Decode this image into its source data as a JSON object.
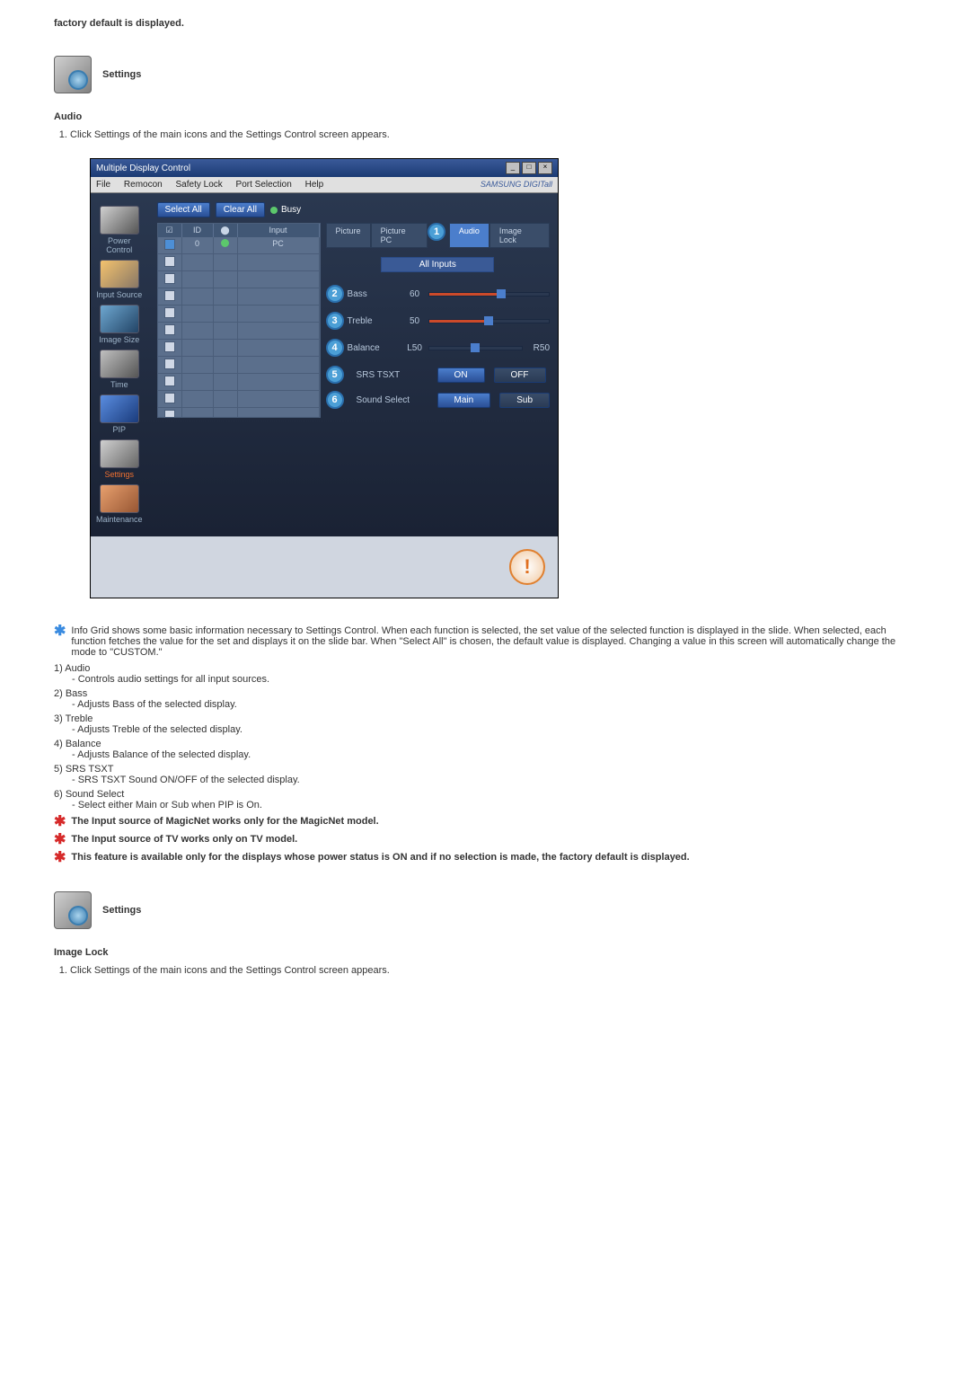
{
  "top_text": "factory default is displayed.",
  "heading1": "Settings",
  "section1_title": "Audio",
  "section1_steps": [
    "Click Settings of the main icons and the Settings Control screen appears."
  ],
  "screenshot": {
    "title": "Multiple Display Control",
    "menu": [
      "File",
      "Remocon",
      "Safety Lock",
      "Port Selection",
      "Help"
    ],
    "brand": "SAMSUNG DIGITall",
    "sidebar": [
      {
        "label": "Power Control"
      },
      {
        "label": "Input Source"
      },
      {
        "label": "Image Size"
      },
      {
        "label": "Time"
      },
      {
        "label": "PIP"
      },
      {
        "label": "Settings",
        "active": true
      },
      {
        "label": "Maintenance"
      }
    ],
    "select_all": "Select All",
    "clear_all": "Clear All",
    "busy": "Busy",
    "grid_headers": {
      "chk": "☑",
      "id": "ID",
      "status": "",
      "input": "Input"
    },
    "grid_row0": {
      "id": "0",
      "input": "PC"
    },
    "tabs": [
      {
        "label": "Picture"
      },
      {
        "label": "Picture PC"
      },
      {
        "label": "Audio",
        "active": true,
        "marker": "1"
      },
      {
        "label": "Image Lock"
      }
    ],
    "all_inputs": "All Inputs",
    "sliders": [
      {
        "marker": "2",
        "label": "Bass",
        "value": "60",
        "pct": 60
      },
      {
        "marker": "3",
        "label": "Treble",
        "value": "50",
        "pct": 50
      },
      {
        "marker": "4",
        "label": "Balance",
        "value_l": "L50",
        "value_r": "R50",
        "pct": 50
      }
    ],
    "button_rows": [
      {
        "marker": "5",
        "label": "SRS TSXT",
        "opt1": "ON",
        "opt2": "OFF"
      },
      {
        "marker": "6",
        "label": "Sound Select",
        "opt1": "Main",
        "opt2": "Sub"
      }
    ]
  },
  "main_note": "Info Grid shows some basic information necessary to Settings Control. When each function is selected, the set value of the selected function is displayed in the slide. When selected, each function fetches the value for the set and displays it on the slide bar. When \"Select All\" is chosen, the default value is displayed. Changing a value in this screen will automatically change the mode to \"CUSTOM.\"",
  "items": [
    {
      "n": "1)",
      "title": "Audio",
      "desc": "- Controls audio settings for all input sources."
    },
    {
      "n": "2)",
      "title": "Bass",
      "desc": "- Adjusts Bass of the selected display."
    },
    {
      "n": "3)",
      "title": "Treble",
      "desc": "- Adjusts Treble of the selected display."
    },
    {
      "n": "4)",
      "title": "Balance",
      "desc": "- Adjusts Balance of the selected display."
    },
    {
      "n": "5)",
      "title": "SRS TSXT",
      "desc": "- SRS TSXT Sound ON/OFF of the selected display."
    },
    {
      "n": "6)",
      "title": "Sound Select",
      "desc": "- Select either Main or Sub when PIP is On."
    }
  ],
  "red_notes": [
    "The Input source of MagicNet works only for the MagicNet model.",
    "The Input source of TV works only on TV model.",
    "This feature is available only for the displays whose power status is ON and if no selection is made, the factory default is displayed."
  ],
  "heading2": "Settings",
  "section2_title": "Image Lock",
  "section2_steps": [
    "Click Settings of the main icons and the Settings Control screen appears."
  ]
}
